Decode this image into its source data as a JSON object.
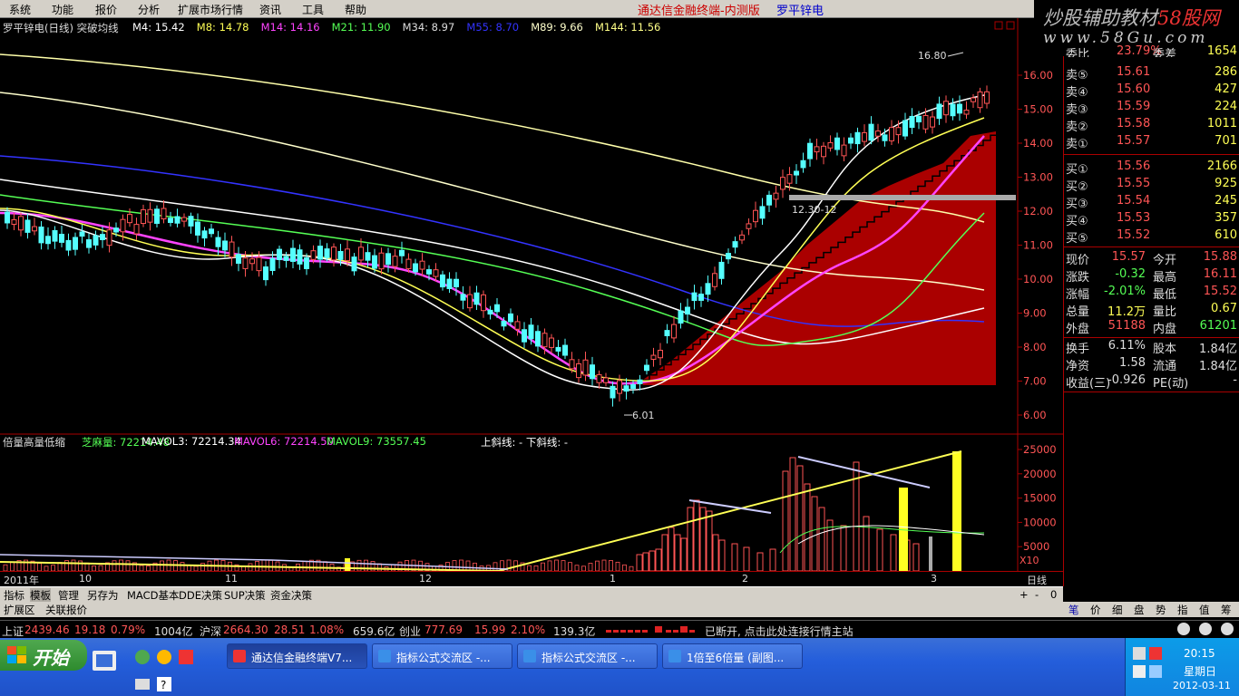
{
  "menu": {
    "items": [
      "系统",
      "功能",
      "报价",
      "分析",
      "扩展市场行情",
      "资讯",
      "工具",
      "帮助"
    ]
  },
  "app_title": "通达信金融终端-内测版",
  "stock_title": "罗平锌电",
  "logo": {
    "text_gray": "炒股辅助教材",
    "text_red": "58股网",
    "url": "www.58Gu.com"
  },
  "main_header": {
    "name": "罗平锌电(日线) 突破均线",
    "ma": [
      {
        "label": "M4: 15.42",
        "color": "#ffffff"
      },
      {
        "label": "M8: 14.78",
        "color": "#ffff55"
      },
      {
        "label": "M14: 14.16",
        "color": "#ff44ff"
      },
      {
        "label": "M21: 11.90",
        "color": "#55ff55"
      },
      {
        "label": "M34: 8.97",
        "color": "#dddddd"
      },
      {
        "label": "M55: 8.70",
        "color": "#3333ff"
      },
      {
        "label": "M89: 9.66",
        "color": "#ffffcc"
      },
      {
        "label": "M144: 11.56",
        "color": "#ffff88"
      }
    ]
  },
  "price_axis": [
    "16.00",
    "15.00",
    "14.00",
    "13.00",
    "12.00",
    "11.00",
    "10.00",
    "9.00",
    "8.00",
    "7.00",
    "6.00"
  ],
  "price_annotations": {
    "high": "16.80",
    "low": "6.01",
    "box": "12.30-12"
  },
  "vol_header": {
    "name": "倍量高量低缩",
    "items": [
      {
        "label": "芝麻量: 72214.48",
        "color": "#55ff55"
      },
      {
        "label": "MAVOL3: 72214.34",
        "color": "#ffffff"
      },
      {
        "label": "MAVOL6: 72214.50",
        "color": "#ff44ff"
      },
      {
        "label": "MAVOL9: 73557.45",
        "color": "#55ff55"
      },
      {
        "label": "上斜线: - 下斜线: -",
        "color": "#ffffff"
      }
    ]
  },
  "vol_axis": [
    "25000",
    "20000",
    "15000",
    "10000",
    "5000"
  ],
  "vol_unit": "X10",
  "date_axis": [
    "2011年",
    "10",
    "11",
    "12",
    "1",
    "2",
    "3"
  ],
  "period": "日线",
  "quote": {
    "partial_row": {
      "label": "委比",
      "value": "23.79%",
      "label2": "委差",
      "value2": "1654"
    },
    "sell": [
      {
        "label": "卖⑤",
        "price": "15.61",
        "vol": "286"
      },
      {
        "label": "卖④",
        "price": "15.60",
        "vol": "427"
      },
      {
        "label": "卖③",
        "price": "15.59",
        "vol": "224"
      },
      {
        "label": "卖②",
        "price": "15.58",
        "vol": "1011"
      },
      {
        "label": "卖①",
        "price": "15.57",
        "vol": "701"
      }
    ],
    "buy": [
      {
        "label": "买①",
        "price": "15.56",
        "vol": "2166"
      },
      {
        "label": "买②",
        "price": "15.55",
        "vol": "925"
      },
      {
        "label": "买③",
        "price": "15.54",
        "vol": "245"
      },
      {
        "label": "买④",
        "price": "15.53",
        "vol": "357"
      },
      {
        "label": "买⑤",
        "price": "15.52",
        "vol": "610"
      }
    ],
    "stats": [
      {
        "l1": "现价",
        "v1": "15.57",
        "c1": "#ff5555",
        "l2": "今开",
        "v2": "15.88",
        "c2": "#ff5555"
      },
      {
        "l1": "涨跌",
        "v1": "-0.32",
        "c1": "#55ff55",
        "l2": "最高",
        "v2": "16.11",
        "c2": "#ff5555"
      },
      {
        "l1": "涨幅",
        "v1": "-2.01%",
        "c1": "#55ff55",
        "l2": "最低",
        "v2": "15.52",
        "c2": "#ff5555"
      },
      {
        "l1": "总量",
        "v1": "11.2万",
        "c1": "#ffff55",
        "l2": "量比",
        "v2": "0.67",
        "c2": "#ffff55"
      },
      {
        "l1": "外盘",
        "v1": "51188",
        "c1": "#ff5555",
        "l2": "内盘",
        "v2": "61201",
        "c2": "#55ff55"
      }
    ],
    "stats2": [
      {
        "l1": "换手",
        "v1": "6.11%",
        "l2": "股本",
        "v2": "1.84亿"
      },
      {
        "l1": "净资",
        "v1": "1.58",
        "l2": "流通",
        "v2": "1.84亿"
      },
      {
        "l1": "收益(三)",
        "v1": "-0.926",
        "l2": "PE(动)",
        "v2": "-"
      }
    ]
  },
  "tabs_row1": [
    "指标",
    "模板",
    "管理",
    "另存为",
    "MACD基本",
    "DDE决策",
    "SUP决策",
    "资金决策"
  ],
  "tabs_row1_controls": [
    "+",
    "-",
    "0"
  ],
  "tabs_row2": [
    "扩展区",
    "关联报价"
  ],
  "right_tabs": [
    "笔",
    "价",
    "细",
    "盘",
    "势",
    "指",
    "值",
    "筹"
  ],
  "statusbar": {
    "sh": {
      "name": "上证",
      "index": "2439.46",
      "change": "19.18",
      "pct": "0.79%",
      "amount": "1004亿"
    },
    "sz": {
      "name": "沪深",
      "index": "2664.30",
      "change": "28.51",
      "pct": "1.08%",
      "amount": "659.6亿"
    },
    "cy": {
      "name": "创业",
      "index": "777.69",
      "change": "15.99",
      "pct": "2.10%",
      "amount": "139.3亿"
    },
    "conn": "已断开, 点击此处连接行情主站"
  },
  "taskbar": {
    "start": "开始",
    "tasks": [
      "通达信金融终端V7...",
      "指标公式交流区 -...",
      "指标公式交流区 -...",
      "1倍至6倍量 (副图..."
    ],
    "clock": {
      "time": "20:15",
      "day": "星期日",
      "date": "2012-03-11"
    }
  },
  "colors": {
    "up": "#ff5555",
    "down": "#55ffff",
    "panel_border": "#aa0000",
    "menu_bg": "#d4d0c8",
    "fill_area": "#aa0000"
  }
}
